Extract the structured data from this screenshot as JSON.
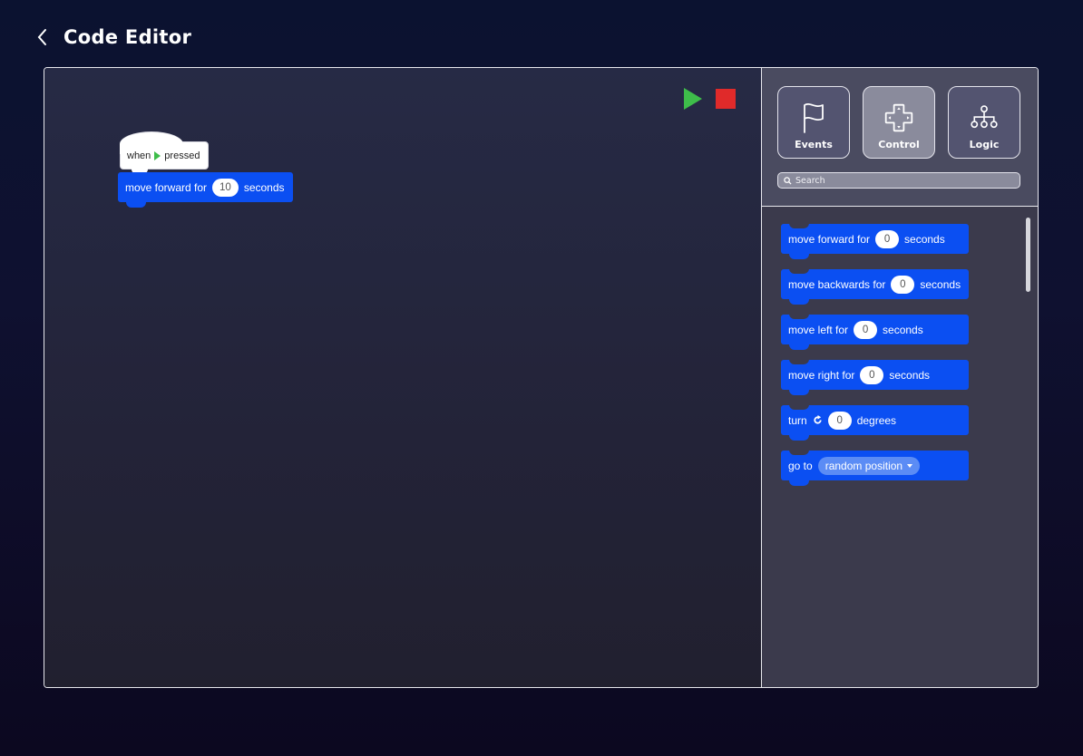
{
  "header": {
    "title": "Code Editor",
    "back_icon": "chevron-left-icon"
  },
  "canvas": {
    "run_controls": {
      "play_icon": "play-icon",
      "stop_icon": "stop-icon",
      "play_color": "#3ebd4a",
      "stop_color": "#e02a2a"
    },
    "script": {
      "hat": {
        "before": "when",
        "icon": "green-flag-triangle-icon",
        "after": "pressed"
      },
      "blocks": [
        {
          "text_before": "move forward for",
          "value": "10",
          "text_after": "seconds"
        }
      ]
    }
  },
  "panel": {
    "categories": [
      {
        "label": "Events",
        "icon": "flag-icon",
        "active": false
      },
      {
        "label": "Control",
        "icon": "dpad-icon",
        "active": true
      },
      {
        "label": "Logic",
        "icon": "hierarchy-icon",
        "active": false
      }
    ],
    "search": {
      "placeholder": "Search",
      "value": ""
    },
    "palette": [
      {
        "text_before": "move forward for",
        "value": "0",
        "text_after": "seconds"
      },
      {
        "text_before": "move backwards for",
        "value": "0",
        "text_after": "seconds"
      },
      {
        "text_before": "move left for",
        "value": "0",
        "text_after": "seconds"
      },
      {
        "text_before": "move right for",
        "value": "0",
        "text_after": "seconds"
      },
      {
        "text_before": "turn",
        "icon": "rotate-clockwise-icon",
        "value": "0",
        "text_after": "degrees"
      },
      {
        "text_before": "go to",
        "dropdown": "random position"
      }
    ]
  },
  "colors": {
    "block_blue": "#0b4ff2",
    "dropdown_blue": "#5b8cf5",
    "panel_bg": "#3b3a4c",
    "active_category": "#8a8b9c"
  }
}
